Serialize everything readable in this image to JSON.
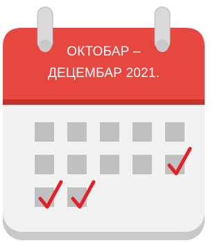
{
  "calendar": {
    "title_line1": "ОКТОБАР –",
    "title_line2": "ДЕЦЕМБАР 2021.",
    "icons": {
      "ring": "calendar-ring-icon",
      "check": "checkmark-icon"
    },
    "colors": {
      "header_red": "#e8473f",
      "header_dark": "#c8322d",
      "body_light": "#f1f1f1",
      "body_shadow": "#c9c9c9",
      "cell_gray": "#c0c0c0",
      "check_red": "#e0202a",
      "ring_gray": "#d9d9d9"
    },
    "cells_per_row": [
      5,
      5,
      2
    ],
    "checked_cells": [
      "row2-col5",
      "row3-col1",
      "row3-col2"
    ]
  }
}
